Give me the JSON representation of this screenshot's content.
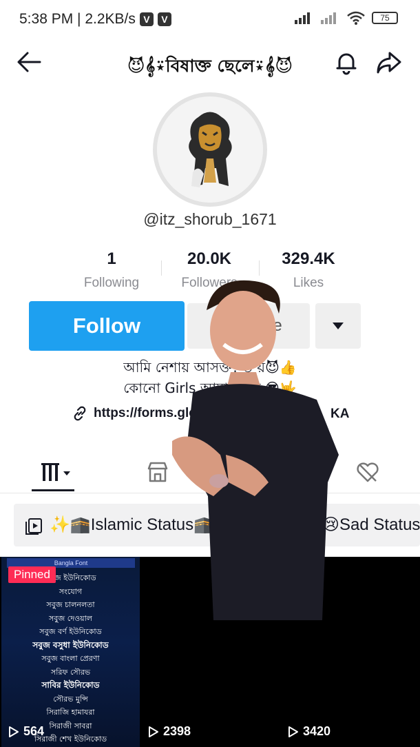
{
  "status_bar": {
    "time_speed": "5:38 PM | 2.2KB/s",
    "battery": "75"
  },
  "header": {
    "profile_name": "😈𝄞⍣বিষাক্ত ছেলে⍣𝄞😈"
  },
  "profile": {
    "username": "@itz_shorub_1671",
    "avatar_icon": "lion-avatar-icon"
  },
  "stats": {
    "following": {
      "value": "1",
      "label": "Following"
    },
    "followers": {
      "value": "20.0K",
      "label": "Followers"
    },
    "likes": {
      "value": "329.4K",
      "label": "Likes"
    }
  },
  "actions": {
    "follow_label": "Follow",
    "message_label": "Message"
  },
  "bio": {
    "line1": "আমি নেশায় আসক্ত! ত                  য়😈👍",
    "line2": "কোনো Girls আমাকে মে                  😎🤟",
    "link_text": "https://forms.gle/",
    "link_tail": "KA"
  },
  "playlists": [
    {
      "label": "✨🕋Islamic Status🕋"
    },
    {
      "label": "😢Sad Status"
    }
  ],
  "videos": [
    {
      "pinned_label": "Pinned",
      "views": "564",
      "header": "Bangla Font",
      "lines": [
        "সবুজ ইউনিকোড",
        "সংযোগ",
        "সবুজ চালনলতা",
        "সবুজ দেওয়াল",
        "সবুজ বর্ণ ইউনিকোড",
        "সবুজ বসুধা ইউনিকোড",
        "সবুজ বাংলা প্রেরণা",
        "সরিফ সৌরভ",
        "সাবির ইউনিকোড",
        "সৌরভ মুন্সি",
        "সিরাজি হামাযরা",
        "সিরাজী সাবরা",
        "সিরাজী শেখ ইউনিকোড"
      ]
    },
    {
      "views": "2398"
    },
    {
      "views": "3420"
    }
  ],
  "colors": {
    "follow_blue": "#1ea0f0",
    "pinned_red": "#fe2c55"
  }
}
